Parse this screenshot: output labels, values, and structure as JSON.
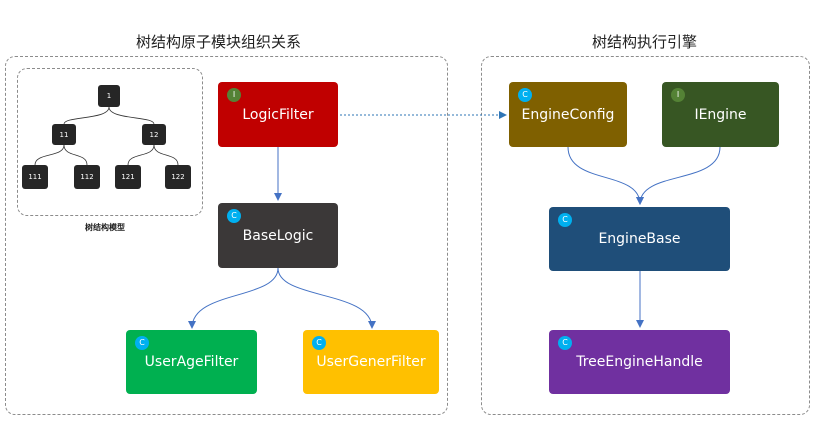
{
  "titles": {
    "left": "树结构原子模块组织关系",
    "right": "树结构执行引擎"
  },
  "tree_model": {
    "caption": "树结构模型",
    "nodes": {
      "n1": "1",
      "n11": "11",
      "n12": "12",
      "n111": "111",
      "n112": "112",
      "n121": "121",
      "n122": "122"
    }
  },
  "nodes": {
    "logicfilter": {
      "label": "LogicFilter",
      "badge": "I",
      "color": "#c00000"
    },
    "baselogic": {
      "label": "BaseLogic",
      "badge": "C",
      "color": "#3b3838"
    },
    "useragefilter": {
      "label": "UserAgeFilter",
      "badge": "C",
      "color": "#00b050"
    },
    "usergenerfilter": {
      "label": "UserGenerFilter",
      "badge": "C",
      "color": "#ffc000"
    },
    "engineconfig": {
      "label": "EngineConfig",
      "badge": "C",
      "color": "#7f6000"
    },
    "iengine": {
      "label": "IEngine",
      "badge": "I",
      "color": "#375623"
    },
    "enginebase": {
      "label": "EngineBase",
      "badge": "C",
      "color": "#1f4e79"
    },
    "treeenginehandle": {
      "label": "TreeEngineHandle",
      "badge": "C",
      "color": "#7030a0"
    }
  },
  "colors": {
    "interface_badge": "#548235",
    "class_badge": "#00b0f0",
    "link": "#4472c4",
    "dashed_link": "#2e75b6"
  }
}
